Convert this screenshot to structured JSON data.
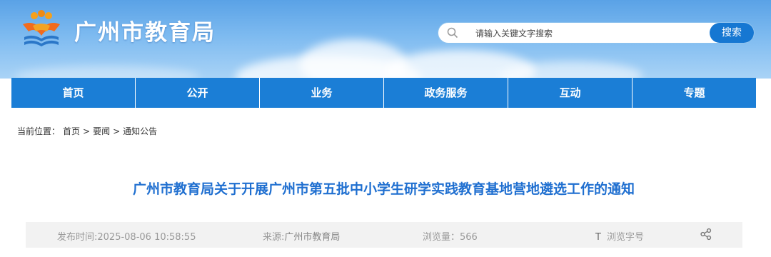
{
  "header": {
    "site_title": "广州市教育局",
    "logo_icon": "guangzhou-education-logo-icon"
  },
  "search": {
    "placeholder": "请输入关键文字搜索",
    "button_label": "搜索",
    "icon": "search-icon"
  },
  "nav": {
    "items": [
      {
        "label": "首页"
      },
      {
        "label": "公开"
      },
      {
        "label": "业务"
      },
      {
        "label": "政务服务"
      },
      {
        "label": "互动"
      },
      {
        "label": "专题"
      }
    ]
  },
  "breadcrumb": {
    "prefix": "当前位置：",
    "items": [
      "首页",
      "要闻",
      "通知公告"
    ],
    "separator": ">"
  },
  "article": {
    "title": "广州市教育局关于开展广州市第五批中小学生研学实践教育基地营地遴选工作的通知",
    "publish_label": "发布时间:",
    "publish_time": "2025-08-06 10:58:55",
    "source_label": "来源:",
    "source": "广州市教育局",
    "views_label": "浏览量：",
    "views": "566",
    "font_size_label": "浏览字号",
    "font_size_icon": "T",
    "share_icon": "share-icon"
  },
  "colors": {
    "nav_bg": "#1b7ed6",
    "title_color": "#1f6fd0",
    "search_button": "#1677d2"
  }
}
